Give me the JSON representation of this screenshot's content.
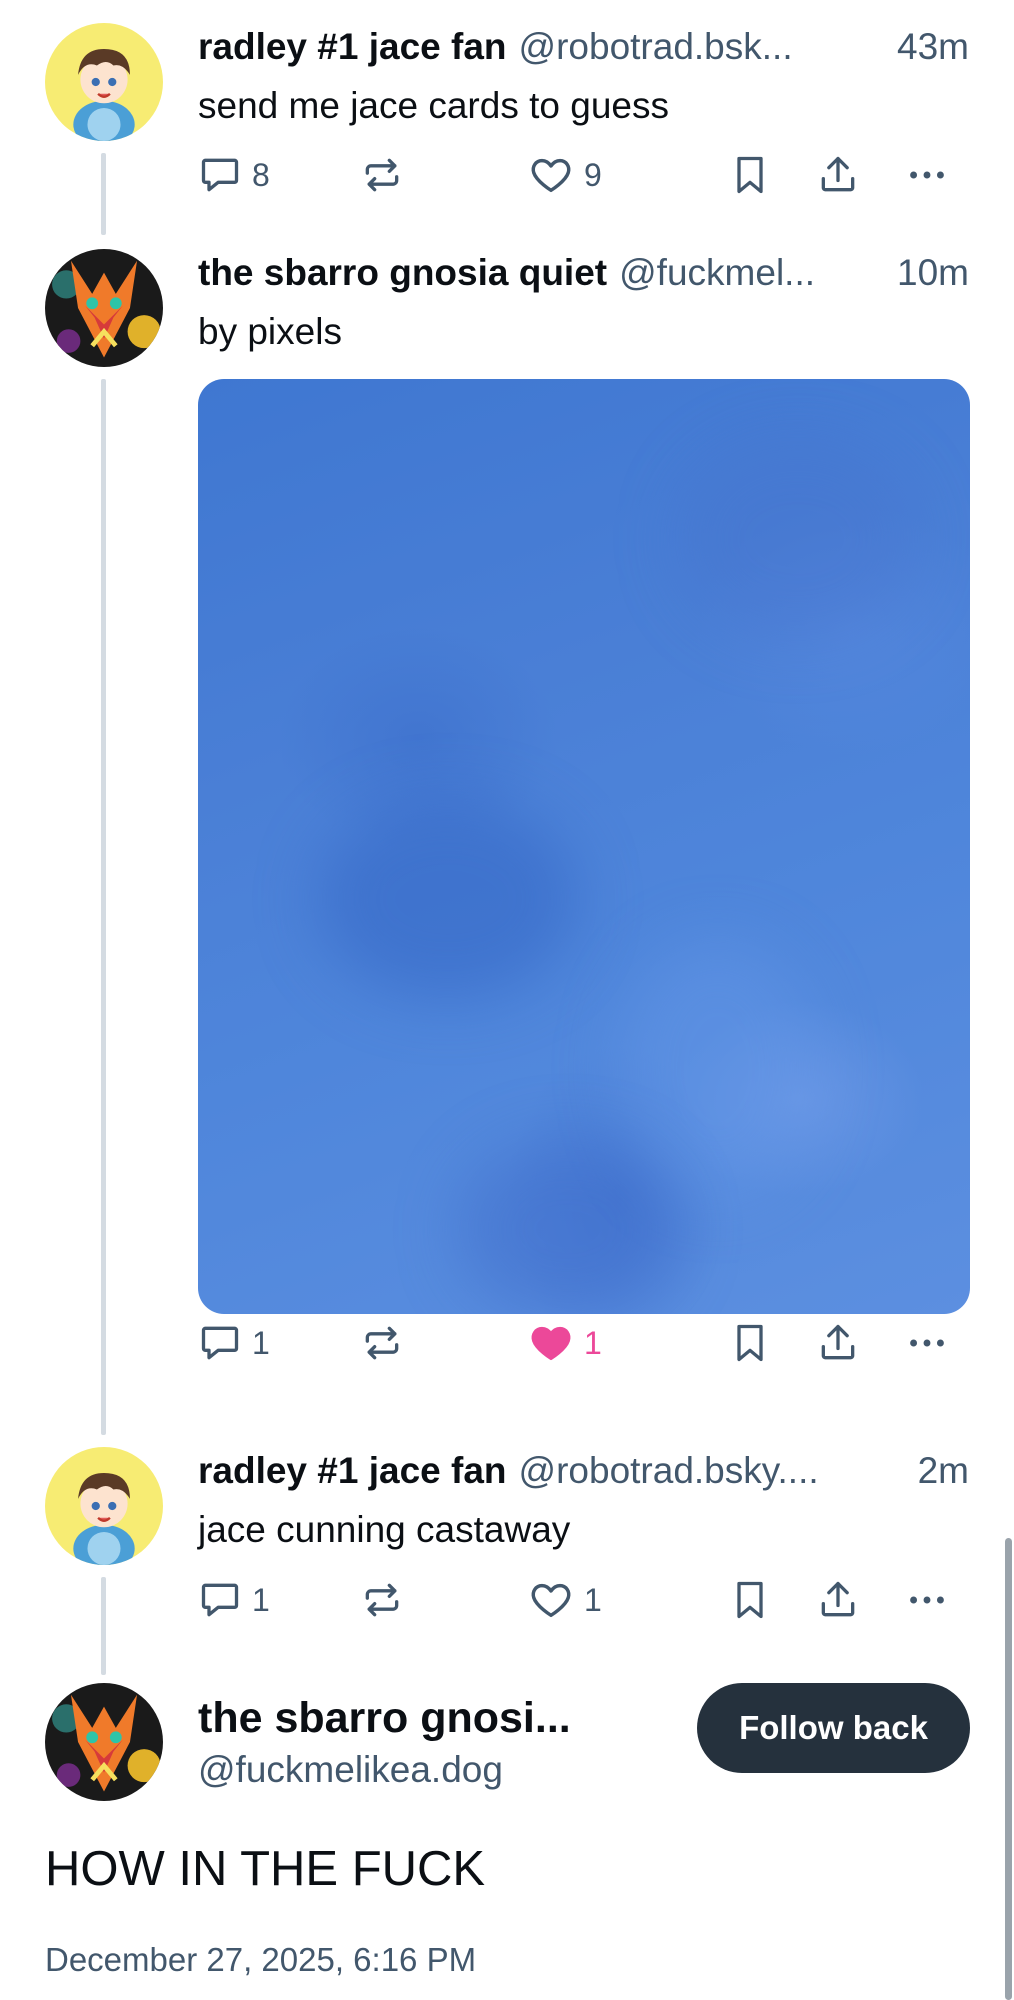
{
  "thread": [
    {
      "display_name": "radley #1 jace fan",
      "handle": "@robotrad.bsk...",
      "time": "43m",
      "text": "send me jace cards to guess",
      "replies": "8",
      "likes": "9",
      "liked": false
    },
    {
      "display_name": "the sbarro gnosia quiet",
      "handle": "@fuckmel...",
      "time": "10m",
      "text": "by pixels",
      "replies": "1",
      "likes": "1",
      "liked": true
    },
    {
      "display_name": "radley #1 jace fan",
      "handle": "@robotrad.bsky....",
      "time": "2m",
      "text": "jace cunning castaway",
      "replies": "1",
      "likes": "1",
      "liked": false
    }
  ],
  "main_post": {
    "display_name": "the sbarro gnosi...",
    "handle": "@fuckmelikea.dog",
    "follow_label": "Follow back",
    "text": "HOW IN THE FUCK",
    "date": "December 27, 2025, 6:16 PM"
  },
  "colors": {
    "liked": "#ec4899",
    "muted": "#42576c",
    "follow_button": "#25313d",
    "thread_line": "#d4dbe2"
  },
  "icons": [
    "reply-icon",
    "repost-icon",
    "like-icon",
    "bookmark-icon",
    "share-icon",
    "more-icon"
  ]
}
